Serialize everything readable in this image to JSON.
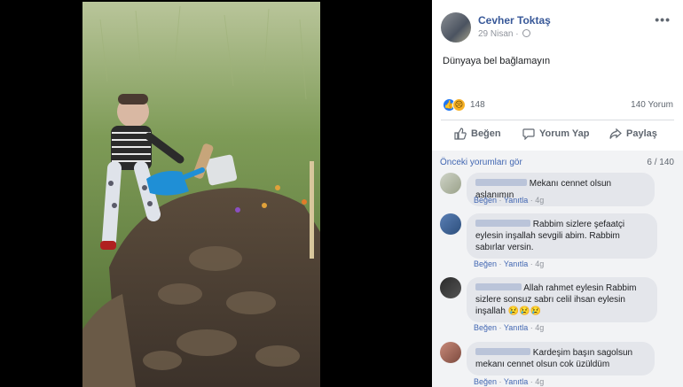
{
  "post": {
    "author": "Cevher Toktaş",
    "date": "29 Nisan",
    "text": "Dünyaya bel bağlamayın",
    "reaction_count": "148",
    "comment_count": "140 Yorum",
    "more_label": "•••"
  },
  "actions": {
    "like": "Beğen",
    "comment": "Yorum Yap",
    "share": "Paylaş"
  },
  "comments_section": {
    "previous_link": "Önceki yorumları gör",
    "shown_count": "6 / 140"
  },
  "comments": [
    {
      "text": "Mekanı cennet olsun aslanımın",
      "like": "Beğen",
      "reply": "Yanıtla",
      "time": "4g"
    },
    {
      "text": "Rabbim sizlere şefaatçi eylesin inşallah sevgili abim. Rabbim sabırlar versin.",
      "like": "Beğen",
      "reply": "Yanıtla",
      "time": "4g"
    },
    {
      "text": "Allah rahmet eylesin Rabbim sizlere sonsuz sabrı celil ihsan eylesin inşallah 😢😢😢",
      "like": "Beğen",
      "reply": "Yanıtla",
      "time": "4g"
    },
    {
      "text": "Kardeşim başın sagolsun mekanı cennet olsun cok üzüldüm",
      "like": "Beğen",
      "reply": "Yanıtla",
      "time": "4g"
    }
  ],
  "colors": {
    "link": "#385898",
    "like_blue": "#2078f4",
    "comment_bg": "#f2f3f5"
  },
  "icons": [
    "globe-icon",
    "like-reaction-icon",
    "sad-reaction-icon",
    "thumbs-up-icon",
    "comment-icon",
    "share-icon"
  ]
}
